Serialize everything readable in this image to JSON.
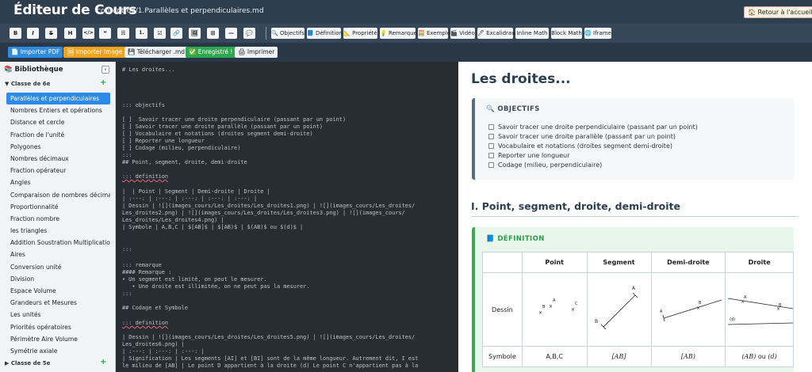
{
  "app": {
    "title": "Éditeur de Cours",
    "path": "content/6e/1.Parallèles et perpendiculaires.md",
    "home_button": "🏠 Retour à l'accueil"
  },
  "toolbar": {
    "format_buttons": [
      "B",
      "I",
      "S",
      "H",
      "</>",
      "❝",
      "☰",
      "1.",
      "☑",
      "🔗",
      "🖼",
      "⊞",
      "—",
      "💬"
    ],
    "block_buttons": [
      "🔍 Objectifs",
      "📘 Définition",
      "📐 Propriété",
      "💡 Remarque",
      "🧮 Exemple",
      "🎬 Vidéo",
      "🖊 Excalidraw",
      "Inline Math",
      "Block Math",
      "🌐 Iframe"
    ]
  },
  "actions": {
    "import_pdf": "📄 Importer PDF",
    "import_image": "🖼 Importer Image",
    "download": "💾 Télécharger .md",
    "saved": "✅ Enregistré !",
    "print": "🖨 Imprimer"
  },
  "sidebar": {
    "title": "📚 Bibliothèque",
    "collapse": "‹",
    "class1": "▼ Classe de 6e",
    "class2": "▶ Classe de 5e",
    "add": "+",
    "lessons": [
      "Parallèles et perpendiculaires",
      "Nombres Entiers et opérations",
      "Distance et cercle",
      "Fraction de l'unité",
      "Polygones",
      "Nombres décimaux",
      "Fraction opérateur",
      "Angles",
      "Comparaison de nombres décima...",
      "Proportionnalité",
      "Fraction nombre",
      "les triangles",
      "Addition Soustration Multiplicatio...",
      "Aires",
      "Conversion unité",
      "Division",
      "Espace Volume",
      "Grandeurs et Mesures",
      "Les unités",
      "Priorités opératoires",
      "Périmètre Aire Volume",
      "Symétrie axiale"
    ]
  },
  "editor": {
    "lines": [
      "# Les droites...",
      "::: objectifs",
      "[ ]  Savoir tracer une droite perpendiculaire (passant par un point)",
      "[ ] Savoir tracer une droite parallèle (passant par un point)",
      "[ ] Vocabulaire et notations (droites segment demi-droite)",
      "[ ] Reporter une longueur",
      "[ ] Codage (milieu, perpendiculaire)",
      ":::",
      "## Point, segment, droite, demi-droite",
      "::: definition",
      "|  | Point | Segment | Demi-droite | Droite |",
      "| :---: | :---: | :---: | :---: | :---: |",
      "| Dessin | ![](images_cours/Les_droites/Les_droites1.png) | ![](images_cours/Les_droites/",
      "Les_droites2.png) | ![](images_cours/Les_droites/Les_droites3.png) | ![](images_cours/",
      "Les_droites/Les_droites4.png) |",
      "| Symbole | A,B,C | $[AB]$ | $[AB)$ | $(AB)$ ou $(d)$ |",
      ":::",
      "::: remarque",
      "#### Remarque :",
      "• Un segment est limité, on peut le mesurer.",
      "   • Une droite est illimitée, on ne peut pas la mesurer.",
      ":::",
      "## Codage et Symbole",
      "::: definition",
      "| Dessin | ![](images_cours/Les_droites/Les_droites5.png) | ![](images_cours/Les_droites/",
      "Les_droites6.png) |",
      "| :---: | :---: | :---: |",
      "| Signification | Les segments [AI] et [BI] sont de la même longueur. Autrement dit, I est",
      "le milieu de [AB] | Le point D appartient à la droite (d) Le point C n'appartient pas à la"
    ]
  },
  "preview": {
    "title": "Les droites...",
    "objectives_label": "🔍 OBJECTIFS",
    "objectives": [
      "Savoir tracer une droite perpendiculaire (passant par un point)",
      "Savoir tracer une droite parallèle (passant par un point)",
      "Vocabulaire et notations (droites segment demi-droite)",
      "Reporter une longueur",
      "Codage (milieu, perpendiculaire)"
    ],
    "section1": "I. Point, segment, droite, demi-droite",
    "definition_label": "📘 DÉFINITION",
    "table": {
      "headers": [
        "",
        "Point",
        "Segment",
        "Demi-droite",
        "Droite"
      ],
      "row_dessin": "Dessin",
      "row_symbole": [
        "Symbole",
        "A,B,C",
        "[AB]",
        "[AB)",
        "(AB)",
        "ou",
        "(d)"
      ],
      "fig_labels": {
        "A": "A",
        "B": "B",
        "C": "C",
        "d": "(d)"
      }
    }
  }
}
